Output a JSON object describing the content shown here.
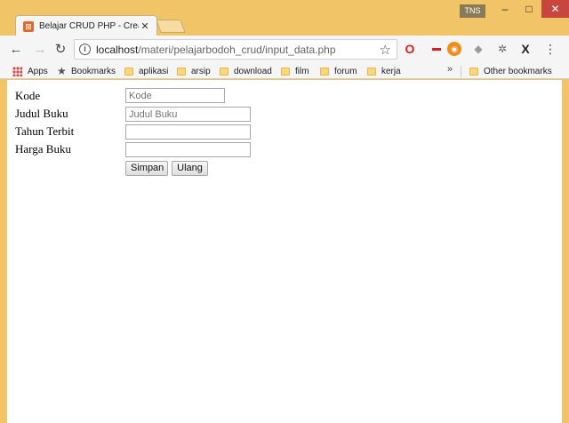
{
  "window": {
    "profile_badge": "TNS",
    "minimize_glyph": "–",
    "maximize_glyph": "□",
    "close_glyph": "✕"
  },
  "tab": {
    "title": "Belajar CRUD PHP - Crea",
    "favicon": "xampp-icon",
    "close_glyph": "✕"
  },
  "toolbar": {
    "url_host": "localhost",
    "url_path": "/materi/pelajarbodoh_crud/input_data.php",
    "extensions": [
      "opera-icon",
      "red-extension-icon",
      "orange-extension-icon",
      "gray-extension-icon",
      "puzzle-extension-icon",
      "x-extension-icon"
    ]
  },
  "bookmarks": {
    "items": [
      {
        "label": "Apps",
        "icon": "apps-icon"
      },
      {
        "label": "Bookmarks",
        "icon": "star-icon"
      },
      {
        "label": "aplikasi",
        "icon": "folder-icon"
      },
      {
        "label": "arsip",
        "icon": "folder-icon"
      },
      {
        "label": "download",
        "icon": "folder-icon"
      },
      {
        "label": "film",
        "icon": "folder-icon"
      },
      {
        "label": "forum",
        "icon": "folder-icon"
      },
      {
        "label": "kerja",
        "icon": "folder-icon"
      }
    ],
    "overflow": "»",
    "other": "Other bookmarks"
  },
  "form": {
    "fields": [
      {
        "label": "Kode",
        "placeholder": "Kode",
        "value": ""
      },
      {
        "label": "Judul Buku",
        "placeholder": "Judul Buku",
        "value": ""
      },
      {
        "label": "Tahun Terbit",
        "placeholder": "",
        "value": ""
      },
      {
        "label": "Harga Buku",
        "placeholder": "",
        "value": ""
      }
    ],
    "submit_label": "Simpan",
    "reset_label": "Ulang"
  }
}
